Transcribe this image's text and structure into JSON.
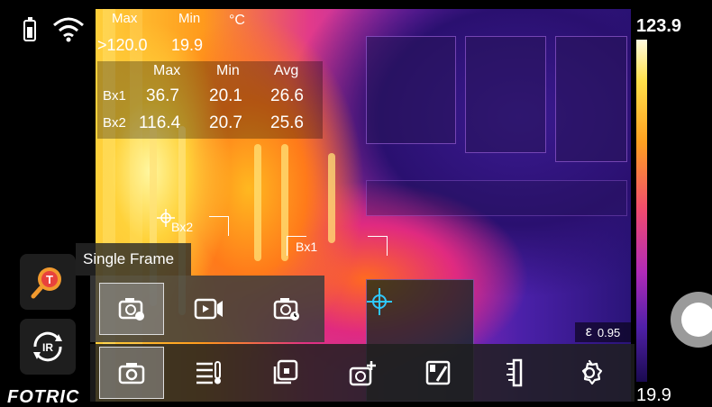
{
  "status": {
    "battery_icon": "battery-icon",
    "wifi_icon": "wifi-icon"
  },
  "measurements": {
    "max_label": "Max",
    "min_label": "Min",
    "unit": "°C",
    "max_value": ">120.0",
    "min_value": "19.9"
  },
  "box_table": {
    "headers": [
      "Max",
      "Min",
      "Avg"
    ],
    "rows": [
      {
        "label": "Bx1",
        "max": "36.7",
        "min": "20.1",
        "avg": "26.6"
      },
      {
        "label": "Bx2",
        "max": "116.4",
        "min": "20.7",
        "avg": "25.6"
      }
    ]
  },
  "markers": {
    "bx1": "Bx1",
    "bx2": "Bx2"
  },
  "scale": {
    "max": "123.9",
    "min": "19.9"
  },
  "emissivity": {
    "symbol": "ε",
    "value": "0.95"
  },
  "mode_tooltip": "Single Frame",
  "sub_toolbar": [
    {
      "icon": "camera-single-frame-icon",
      "selected": true
    },
    {
      "icon": "video-icon",
      "selected": false
    },
    {
      "icon": "timed-capture-icon",
      "selected": false
    }
  ],
  "toolbar": [
    {
      "icon": "camera-icon",
      "selected": true
    },
    {
      "icon": "measure-list-icon",
      "selected": false
    },
    {
      "icon": "fusion-icon",
      "selected": false
    },
    {
      "icon": "add-tool-icon",
      "selected": false
    },
    {
      "icon": "palette-icon",
      "selected": false
    },
    {
      "icon": "scale-ruler-icon",
      "selected": false
    },
    {
      "icon": "settings-icon",
      "selected": false
    }
  ],
  "left_buttons": [
    {
      "icon": "temperature-search-icon"
    },
    {
      "icon": "ir-switch-icon",
      "label": "IR"
    }
  ],
  "brand": "FOTRIC",
  "colors": {
    "accent": "#f0a020",
    "marker": "#2fc8ff"
  }
}
